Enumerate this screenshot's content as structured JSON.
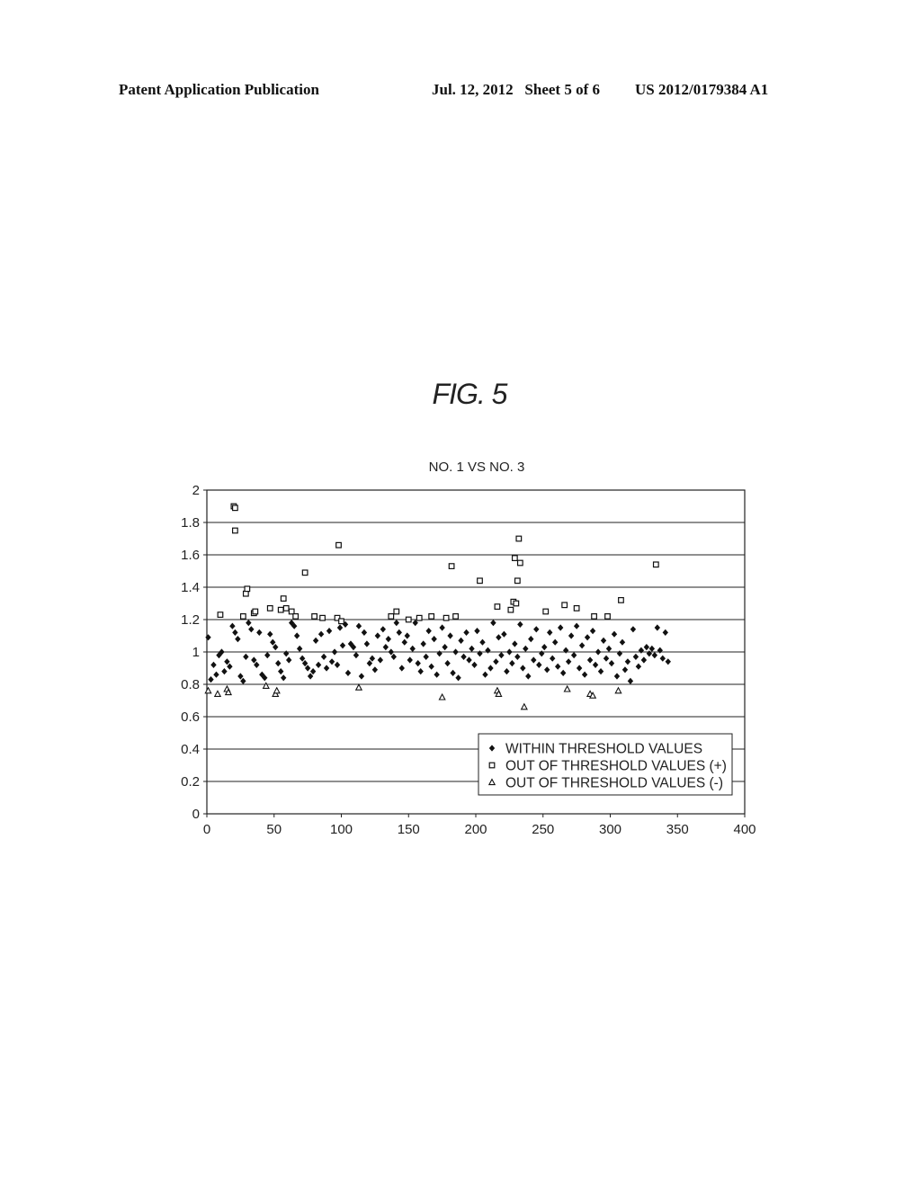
{
  "header": {
    "publication": "Patent Application Publication",
    "date_sheet": "Jul. 12, 2012   Sheet 5 of 6",
    "patent_number": "US 2012/0179384 A1"
  },
  "figure": {
    "label": "FIG. 5"
  },
  "chart_data": {
    "type": "scatter",
    "title": "NO. 1 VS NO. 3",
    "xlabel": "",
    "ylabel": "",
    "xlim": [
      0,
      400
    ],
    "ylim": [
      0,
      2
    ],
    "x_ticks": [
      "0",
      "50",
      "100",
      "150",
      "200",
      "250",
      "300",
      "350",
      "400"
    ],
    "y_ticks": [
      "0",
      "0.2",
      "0.4",
      "0.6",
      "0.8",
      "1",
      "1.2",
      "1.4",
      "1.6",
      "1.8",
      "2"
    ],
    "grid": "horizontal",
    "legend_position": "bottom-right",
    "series": [
      {
        "name": "WITHIN THRESHOLD VALUES",
        "marker": "diamond",
        "points": [
          [
            1,
            1.09
          ],
          [
            3,
            0.83
          ],
          [
            5,
            0.92
          ],
          [
            7,
            0.86
          ],
          [
            9,
            0.98
          ],
          [
            11,
            1.0
          ],
          [
            13,
            0.88
          ],
          [
            15,
            0.94
          ],
          [
            17,
            0.91
          ],
          [
            19,
            1.16
          ],
          [
            21,
            1.12
          ],
          [
            23,
            1.08
          ],
          [
            25,
            0.85
          ],
          [
            27,
            0.82
          ],
          [
            29,
            0.97
          ],
          [
            31,
            1.18
          ],
          [
            33,
            1.14
          ],
          [
            35,
            0.95
          ],
          [
            37,
            0.92
          ],
          [
            39,
            1.12
          ],
          [
            41,
            0.86
          ],
          [
            43,
            0.84
          ],
          [
            45,
            0.98
          ],
          [
            47,
            1.11
          ],
          [
            49,
            1.06
          ],
          [
            51,
            1.03
          ],
          [
            53,
            0.93
          ],
          [
            55,
            0.88
          ],
          [
            57,
            0.84
          ],
          [
            59,
            0.99
          ],
          [
            61,
            0.95
          ],
          [
            63,
            1.18
          ],
          [
            65,
            1.16
          ],
          [
            67,
            1.1
          ],
          [
            69,
            1.02
          ],
          [
            71,
            0.96
          ],
          [
            73,
            0.93
          ],
          [
            75,
            0.9
          ],
          [
            77,
            0.85
          ],
          [
            79,
            0.88
          ],
          [
            81,
            1.07
          ],
          [
            83,
            0.92
          ],
          [
            85,
            1.11
          ],
          [
            87,
            0.97
          ],
          [
            89,
            0.9
          ],
          [
            91,
            1.13
          ],
          [
            93,
            0.94
          ],
          [
            95,
            1.0
          ],
          [
            97,
            0.92
          ],
          [
            99,
            1.15
          ],
          [
            101,
            1.04
          ],
          [
            103,
            1.17
          ],
          [
            105,
            0.87
          ],
          [
            107,
            1.05
          ],
          [
            109,
            1.03
          ],
          [
            111,
            0.98
          ],
          [
            113,
            1.16
          ],
          [
            115,
            0.85
          ],
          [
            117,
            1.12
          ],
          [
            119,
            1.05
          ],
          [
            121,
            0.93
          ],
          [
            123,
            0.96
          ],
          [
            125,
            0.89
          ],
          [
            127,
            1.1
          ],
          [
            129,
            0.95
          ],
          [
            131,
            1.14
          ],
          [
            133,
            1.03
          ],
          [
            135,
            1.08
          ],
          [
            137,
            1.0
          ],
          [
            139,
            0.97
          ],
          [
            141,
            1.18
          ],
          [
            143,
            1.12
          ],
          [
            145,
            0.9
          ],
          [
            147,
            1.06
          ],
          [
            149,
            1.1
          ],
          [
            151,
            0.95
          ],
          [
            153,
            1.02
          ],
          [
            155,
            1.18
          ],
          [
            157,
            0.93
          ],
          [
            159,
            0.88
          ],
          [
            161,
            1.05
          ],
          [
            163,
            0.97
          ],
          [
            165,
            1.13
          ],
          [
            167,
            0.91
          ],
          [
            169,
            1.08
          ],
          [
            171,
            0.86
          ],
          [
            173,
            0.99
          ],
          [
            175,
            1.15
          ],
          [
            177,
            1.03
          ],
          [
            179,
            0.93
          ],
          [
            181,
            1.1
          ],
          [
            183,
            0.87
          ],
          [
            185,
            1.0
          ],
          [
            187,
            0.84
          ],
          [
            189,
            1.07
          ],
          [
            191,
            0.97
          ],
          [
            193,
            1.12
          ],
          [
            195,
            0.95
          ],
          [
            197,
            1.02
          ],
          [
            199,
            0.92
          ],
          [
            201,
            1.13
          ],
          [
            203,
            0.99
          ],
          [
            205,
            1.06
          ],
          [
            207,
            0.86
          ],
          [
            209,
            1.01
          ],
          [
            211,
            0.9
          ],
          [
            213,
            1.18
          ],
          [
            215,
            0.94
          ],
          [
            217,
            1.09
          ],
          [
            219,
            0.98
          ],
          [
            221,
            1.11
          ],
          [
            223,
            0.88
          ],
          [
            225,
            1.0
          ],
          [
            227,
            0.93
          ],
          [
            229,
            1.05
          ],
          [
            231,
            0.97
          ],
          [
            233,
            1.17
          ],
          [
            235,
            0.9
          ],
          [
            237,
            1.02
          ],
          [
            239,
            0.85
          ],
          [
            241,
            1.08
          ],
          [
            243,
            0.95
          ],
          [
            245,
            1.14
          ],
          [
            247,
            0.92
          ],
          [
            249,
            0.99
          ],
          [
            251,
            1.03
          ],
          [
            253,
            0.89
          ],
          [
            255,
            1.12
          ],
          [
            257,
            0.96
          ],
          [
            259,
            1.06
          ],
          [
            261,
            0.91
          ],
          [
            263,
            1.15
          ],
          [
            265,
            0.87
          ],
          [
            267,
            1.01
          ],
          [
            269,
            0.94
          ],
          [
            271,
            1.1
          ],
          [
            273,
            0.98
          ],
          [
            275,
            1.16
          ],
          [
            277,
            0.9
          ],
          [
            279,
            1.04
          ],
          [
            281,
            0.86
          ],
          [
            283,
            1.09
          ],
          [
            285,
            0.95
          ],
          [
            287,
            1.13
          ],
          [
            289,
            0.92
          ],
          [
            291,
            1.0
          ],
          [
            293,
            0.88
          ],
          [
            295,
            1.07
          ],
          [
            297,
            0.96
          ],
          [
            299,
            1.02
          ],
          [
            301,
            0.93
          ],
          [
            303,
            1.11
          ],
          [
            305,
            0.85
          ],
          [
            307,
            0.99
          ],
          [
            309,
            1.06
          ],
          [
            311,
            0.89
          ],
          [
            313,
            0.94
          ],
          [
            315,
            0.82
          ],
          [
            317,
            1.14
          ],
          [
            319,
            0.97
          ],
          [
            321,
            0.91
          ],
          [
            323,
            1.01
          ],
          [
            325,
            0.95
          ],
          [
            327,
            1.03
          ],
          [
            329,
            0.99
          ],
          [
            331,
            1.02
          ],
          [
            333,
            0.98
          ],
          [
            335,
            1.15
          ],
          [
            337,
            1.01
          ],
          [
            339,
            0.96
          ],
          [
            341,
            1.12
          ],
          [
            343,
            0.94
          ]
        ]
      },
      {
        "name": "OUT OF THRESHOLD VALUES (+)",
        "marker": "square",
        "points": [
          [
            10,
            1.23
          ],
          [
            20,
            1.9
          ],
          [
            21,
            1.89
          ],
          [
            21,
            1.75
          ],
          [
            27,
            1.22
          ],
          [
            29,
            1.36
          ],
          [
            30,
            1.39
          ],
          [
            35,
            1.24
          ],
          [
            36,
            1.25
          ],
          [
            47,
            1.27
          ],
          [
            55,
            1.26
          ],
          [
            57,
            1.33
          ],
          [
            59,
            1.27
          ],
          [
            63,
            1.25
          ],
          [
            66,
            1.22
          ],
          [
            73,
            1.49
          ],
          [
            80,
            1.22
          ],
          [
            86,
            1.21
          ],
          [
            97,
            1.21
          ],
          [
            98,
            1.66
          ],
          [
            100,
            1.19
          ],
          [
            137,
            1.22
          ],
          [
            141,
            1.25
          ],
          [
            150,
            1.2
          ],
          [
            158,
            1.21
          ],
          [
            167,
            1.22
          ],
          [
            178,
            1.21
          ],
          [
            182,
            1.53
          ],
          [
            185,
            1.22
          ],
          [
            203,
            1.44
          ],
          [
            216,
            1.28
          ],
          [
            226,
            1.26
          ],
          [
            228,
            1.31
          ],
          [
            229,
            1.58
          ],
          [
            230,
            1.3
          ],
          [
            231,
            1.44
          ],
          [
            232,
            1.7
          ],
          [
            233,
            1.55
          ],
          [
            252,
            1.25
          ],
          [
            266,
            1.29
          ],
          [
            275,
            1.27
          ],
          [
            288,
            1.22
          ],
          [
            298,
            1.22
          ],
          [
            308,
            1.32
          ],
          [
            334,
            1.54
          ]
        ]
      },
      {
        "name": "OUT OF THRESHOLD VALUES (-)",
        "marker": "triangle",
        "points": [
          [
            1,
            0.76
          ],
          [
            8,
            0.74
          ],
          [
            15,
            0.77
          ],
          [
            16,
            0.75
          ],
          [
            44,
            0.79
          ],
          [
            51,
            0.74
          ],
          [
            52,
            0.76
          ],
          [
            113,
            0.78
          ],
          [
            175,
            0.72
          ],
          [
            216,
            0.76
          ],
          [
            217,
            0.74
          ],
          [
            236,
            0.66
          ],
          [
            268,
            0.77
          ],
          [
            285,
            0.74
          ],
          [
            287,
            0.73
          ],
          [
            306,
            0.76
          ]
        ]
      }
    ]
  }
}
